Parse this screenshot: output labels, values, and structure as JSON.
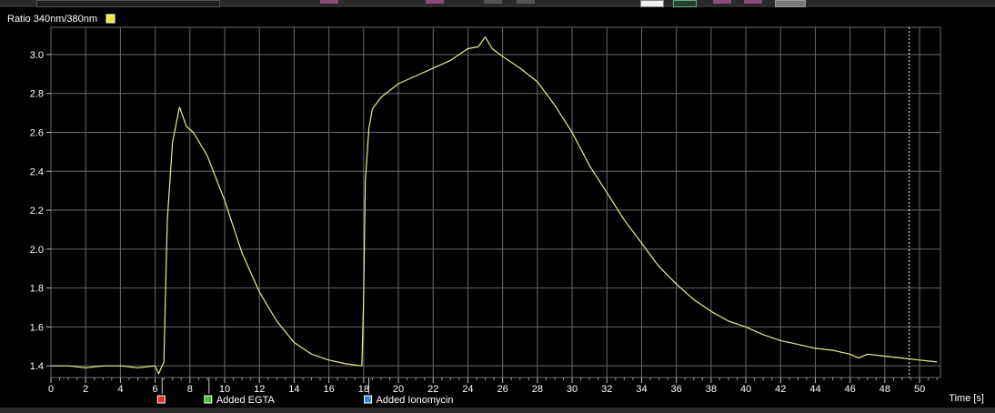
{
  "app": {
    "toolbar_icons": [
      "magnify-icon",
      "marker-icon",
      "star-icon",
      "close-icon",
      "color-swatch-white",
      "color-swatch-green",
      "bar-chart-icon",
      "grey-button"
    ]
  },
  "chart_data": {
    "type": "line",
    "ylabel": "Ratio 340nm/380nm",
    "xlabel": "Time [s]",
    "xlim": [
      0,
      51.2
    ],
    "ylim": [
      1.34,
      3.14
    ],
    "xticks": [
      0,
      2,
      4,
      6,
      8,
      10,
      12,
      14,
      16,
      18,
      20,
      22,
      24,
      26,
      28,
      30,
      32,
      34,
      36,
      38,
      40,
      42,
      44,
      46,
      48,
      50
    ],
    "yticks": [
      1.4,
      1.6,
      1.8,
      2.0,
      2.2,
      2.4,
      2.6,
      2.8,
      3.0
    ],
    "grid": true,
    "colors": {
      "background": "#000000",
      "grid": "#6a6a6a",
      "series": "#ecec8a",
      "axis_text": "#ffffff",
      "cursor": "#ffffff"
    },
    "series": [
      {
        "color": "#ecec8a",
        "x": [
          0,
          1,
          2,
          3,
          4,
          5,
          6,
          6.2,
          6.5,
          6.6,
          6.7,
          7.0,
          7.4,
          7.8,
          8.2,
          9,
          10,
          11,
          12,
          13,
          14,
          15,
          16,
          17,
          17.9,
          18.0,
          18.1,
          18.3,
          18.5,
          19,
          20,
          21,
          22,
          23,
          24,
          24.6,
          25.0,
          25.4,
          26,
          27,
          28,
          29,
          30,
          31,
          32,
          33,
          34,
          35,
          36,
          37,
          38,
          39,
          40,
          41,
          42,
          43,
          44,
          45,
          46,
          46.5,
          47,
          48,
          49,
          50,
          51
        ],
        "y": [
          1.4,
          1.4,
          1.39,
          1.4,
          1.4,
          1.39,
          1.4,
          1.36,
          1.42,
          1.8,
          2.15,
          2.55,
          2.73,
          2.63,
          2.6,
          2.48,
          2.25,
          1.98,
          1.78,
          1.63,
          1.52,
          1.46,
          1.43,
          1.41,
          1.4,
          1.75,
          2.35,
          2.62,
          2.72,
          2.78,
          2.85,
          2.89,
          2.93,
          2.97,
          3.03,
          3.04,
          3.09,
          3.03,
          2.99,
          2.93,
          2.86,
          2.74,
          2.6,
          2.43,
          2.29,
          2.15,
          2.03,
          1.91,
          1.82,
          1.74,
          1.68,
          1.63,
          1.6,
          1.56,
          1.53,
          1.51,
          1.49,
          1.48,
          1.46,
          1.44,
          1.46,
          1.45,
          1.44,
          1.43,
          1.42
        ]
      }
    ],
    "cursor_x": 49.4,
    "events": [
      {
        "x": 6.4,
        "label": "",
        "color": "#e23030"
      },
      {
        "x": 9.1,
        "label": "Added EGTA",
        "color": "#4dbb3a"
      },
      {
        "x": 18.3,
        "label": "Added Ionomycin",
        "color": "#3a86d6"
      }
    ]
  }
}
